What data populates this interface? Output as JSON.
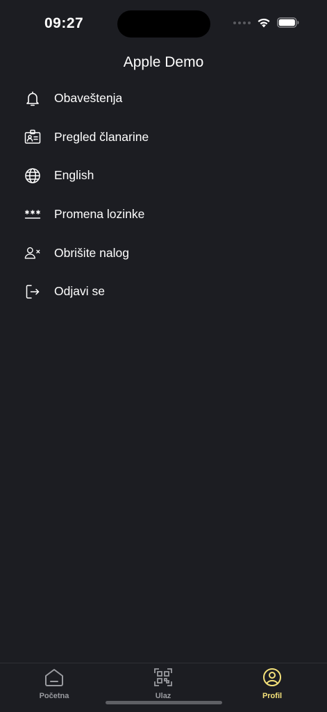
{
  "status_bar": {
    "time": "09:27"
  },
  "header": {
    "title": "Apple Demo"
  },
  "menu": {
    "items": [
      {
        "label": "Obaveštenja",
        "icon": "bell-icon"
      },
      {
        "label": "Pregled članarine",
        "icon": "membership-card-icon"
      },
      {
        "label": "English",
        "icon": "globe-icon"
      },
      {
        "label": "Promena lozinke",
        "icon": "password-icon"
      },
      {
        "label": "Obrišite nalog",
        "icon": "delete-user-icon"
      },
      {
        "label": "Odjavi se",
        "icon": "logout-icon"
      }
    ]
  },
  "tab_bar": {
    "tabs": [
      {
        "label": "Početna",
        "icon": "home-icon",
        "active": false
      },
      {
        "label": "Ulaz",
        "icon": "qr-code-icon",
        "active": false
      },
      {
        "label": "Profil",
        "icon": "profile-icon",
        "active": true
      }
    ]
  },
  "colors": {
    "background": "#1c1d22",
    "accent": "#f5e27a",
    "inactive": "#9a9ba0",
    "text": "#ffffff"
  }
}
